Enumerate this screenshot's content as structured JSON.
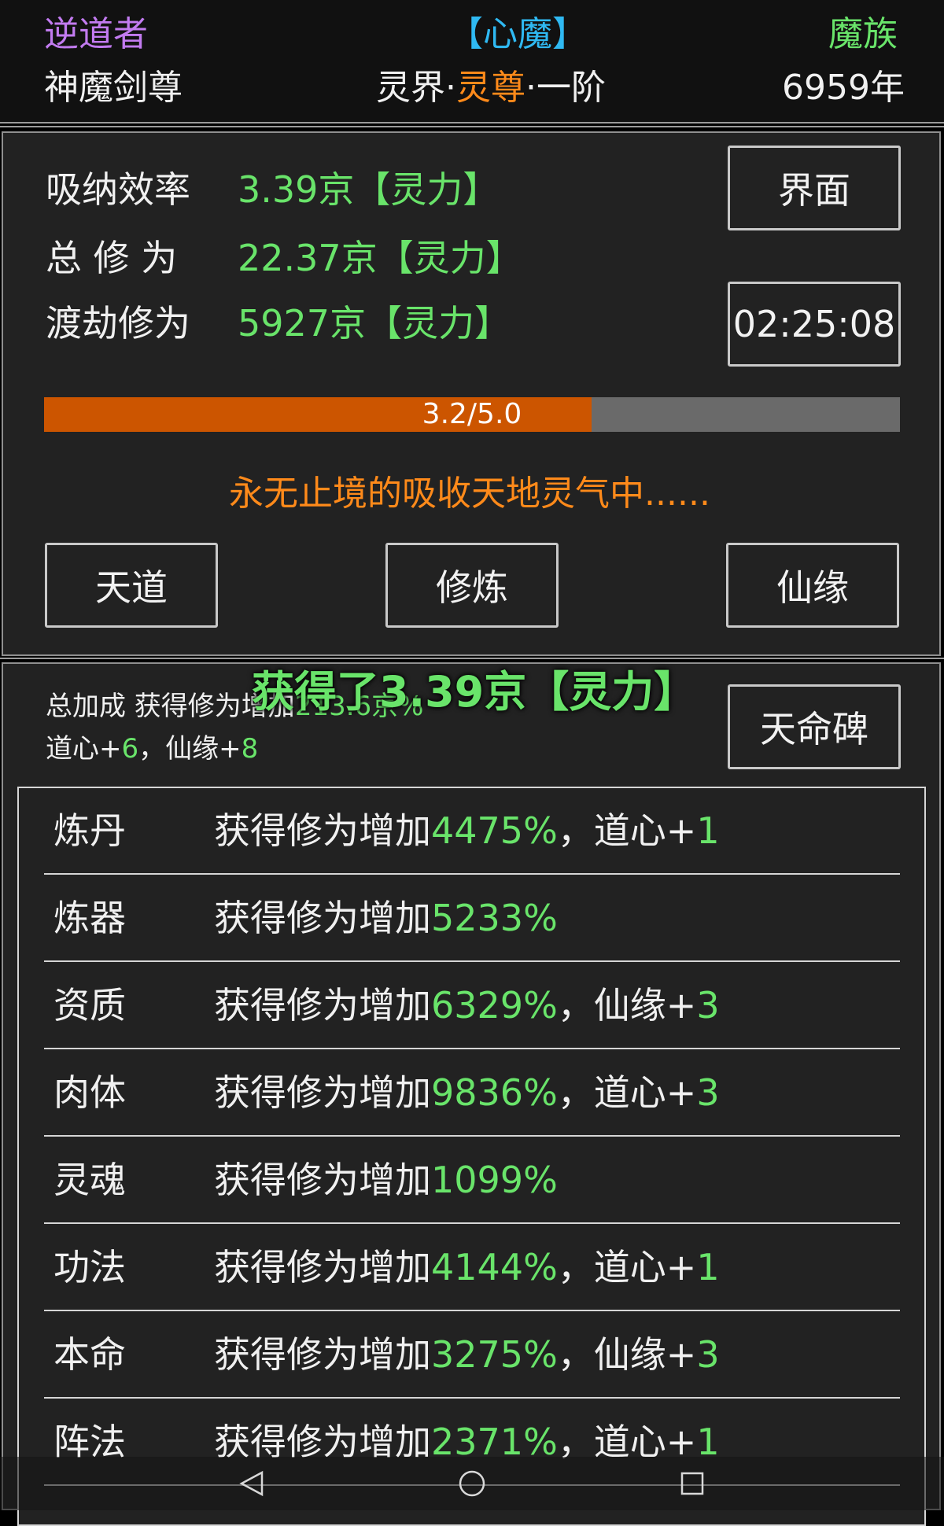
{
  "colors": {
    "green": "#69e46a",
    "orange": "#ff8a1a",
    "purple": "#c27bf0",
    "cyan": "#2fb9f2",
    "bar_fill": "#cc5500",
    "bar_track": "#6a6a6a"
  },
  "header": {
    "role": "逆道者",
    "affliction": "【心魔】",
    "race": "魔族",
    "title": "神魔剑尊",
    "realm_prefix": "灵界·",
    "realm_highlight": "灵尊",
    "realm_suffix": "·一阶",
    "age": "6959年"
  },
  "stats": {
    "absorb_label": "吸纳效率",
    "absorb_value": "3.39京【灵力】",
    "total_label": "总 修 为",
    "total_value": "22.37京【灵力】",
    "tribulation_label": "渡劫修为",
    "tribulation_value": "5927京【灵力】",
    "interface_button": "界面",
    "timer": "02:25:08"
  },
  "progress": {
    "text": "3.2/5.0",
    "value": 3.2,
    "max": 5.0
  },
  "status_message": "永无止境的吸收天地灵气中......",
  "actions": {
    "heaven_way": "天道",
    "cultivate": "修炼",
    "fate": "仙缘"
  },
  "bonus": {
    "line1_prefix": "总加成 获得修为增加",
    "line1_value": "213.6京%",
    "line2_a_label": "道心+",
    "line2_a_value": "6",
    "line2_sep": "，",
    "line2_b_label": "仙缘+",
    "line2_b_value": "8",
    "stele_button": "天命碑"
  },
  "toast": "获得了3.39京【灵力】",
  "list": [
    {
      "name": "炼丹",
      "desc": "获得修为增加",
      "pct": "4475%",
      "extra_label": "，道心+",
      "extra_value": "1"
    },
    {
      "name": "炼器",
      "desc": "获得修为增加",
      "pct": "5233%",
      "extra_label": "",
      "extra_value": ""
    },
    {
      "name": "资质",
      "desc": "获得修为增加",
      "pct": "6329%",
      "extra_label": "，仙缘+",
      "extra_value": "3"
    },
    {
      "name": "肉体",
      "desc": "获得修为增加",
      "pct": "9836%",
      "extra_label": "，道心+",
      "extra_value": "3"
    },
    {
      "name": "灵魂",
      "desc": "获得修为增加",
      "pct": "1099%",
      "extra_label": "",
      "extra_value": ""
    },
    {
      "name": "功法",
      "desc": "获得修为增加",
      "pct": "4144%",
      "extra_label": "，道心+",
      "extra_value": "1"
    },
    {
      "name": "本命",
      "desc": "获得修为增加",
      "pct": "3275%",
      "extra_label": "，仙缘+",
      "extra_value": "3"
    },
    {
      "name": "阵法",
      "desc": "获得修为增加",
      "pct": "2371%",
      "extra_label": "，道心+",
      "extra_value": "1"
    }
  ],
  "navbar": {
    "back_icon": "back-triangle-icon",
    "home_icon": "home-circle-icon",
    "recents_icon": "recents-square-icon"
  }
}
